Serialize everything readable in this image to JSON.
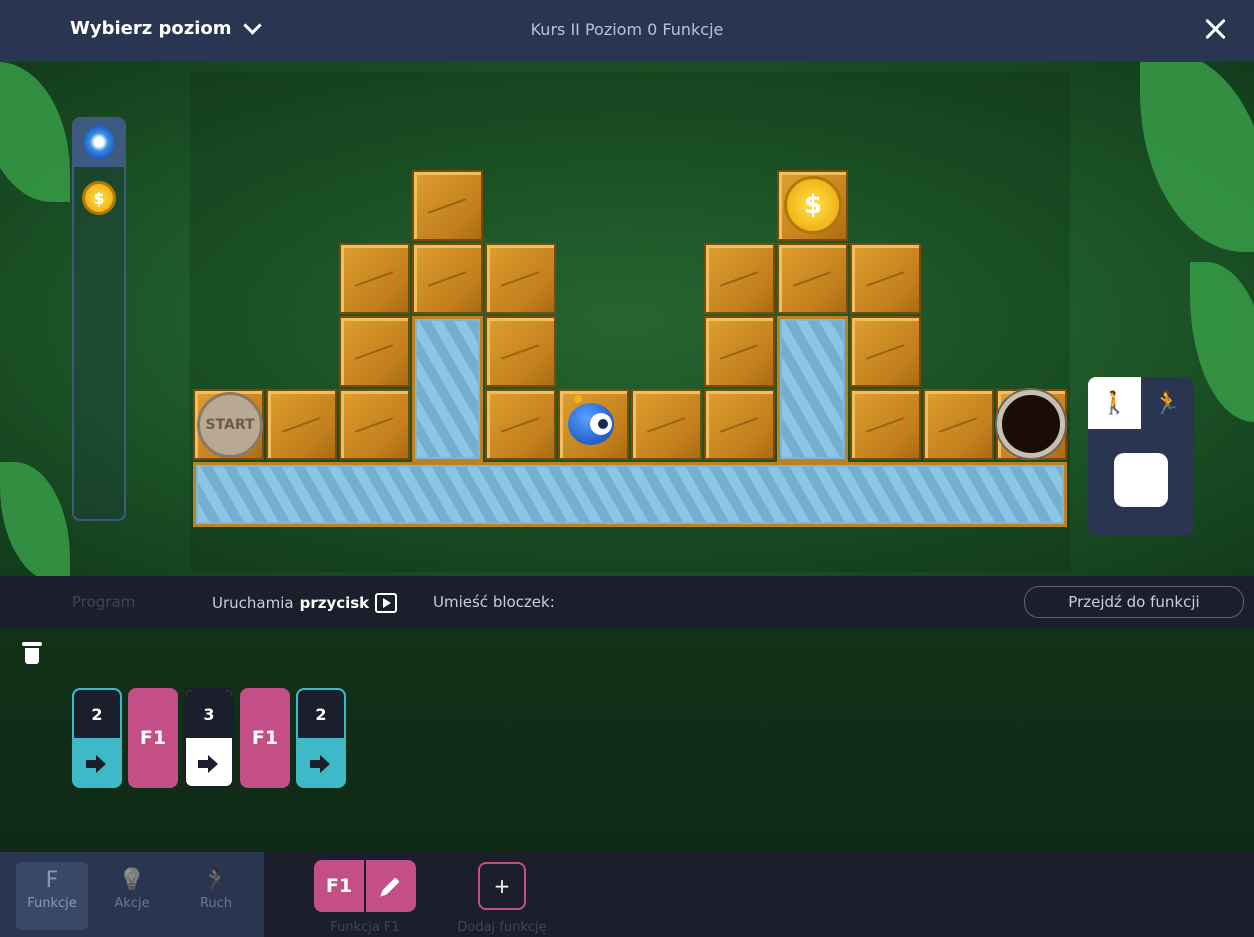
{
  "header": {
    "level_select_label": "Wybierz poziom",
    "title": "Kurs II Poziom 0 Funkcje"
  },
  "board": {
    "start_label": "START",
    "coin_symbol": "$"
  },
  "items_panel": {
    "coin_symbol": "$"
  },
  "speed_panel": {
    "walk_icon": "walk-icon",
    "run_icon": "run-icon"
  },
  "program_bar": {
    "program_tab": "Program",
    "runs_prefix": "Uruchamia",
    "runs_bold": "przycisk",
    "place_block": "Umieść bloczek:",
    "goto_function": "Przejdź do funkcji"
  },
  "program": {
    "blocks": [
      {
        "type": "move",
        "count": "2"
      },
      {
        "type": "function",
        "label": "F1"
      },
      {
        "type": "move",
        "count": "3",
        "selected": true
      },
      {
        "type": "function",
        "label": "F1"
      },
      {
        "type": "move",
        "count": "2"
      }
    ]
  },
  "categories": [
    {
      "label": "Funkcje",
      "glyph": "F",
      "active": true
    },
    {
      "label": "Akcje",
      "glyph": "💡"
    },
    {
      "label": "Ruch",
      "glyph": "🏃"
    }
  ],
  "functions": {
    "f1_label": "F1",
    "f1_caption": "Funkcja F1",
    "add_label": "+",
    "add_caption": "Dodaj funkcję"
  },
  "colors": {
    "topbar": "#2a3651",
    "move_block": "#3fb8c8",
    "function_block": "#c44f86",
    "tile": "#d6962a",
    "water": "#7ab8d8"
  }
}
